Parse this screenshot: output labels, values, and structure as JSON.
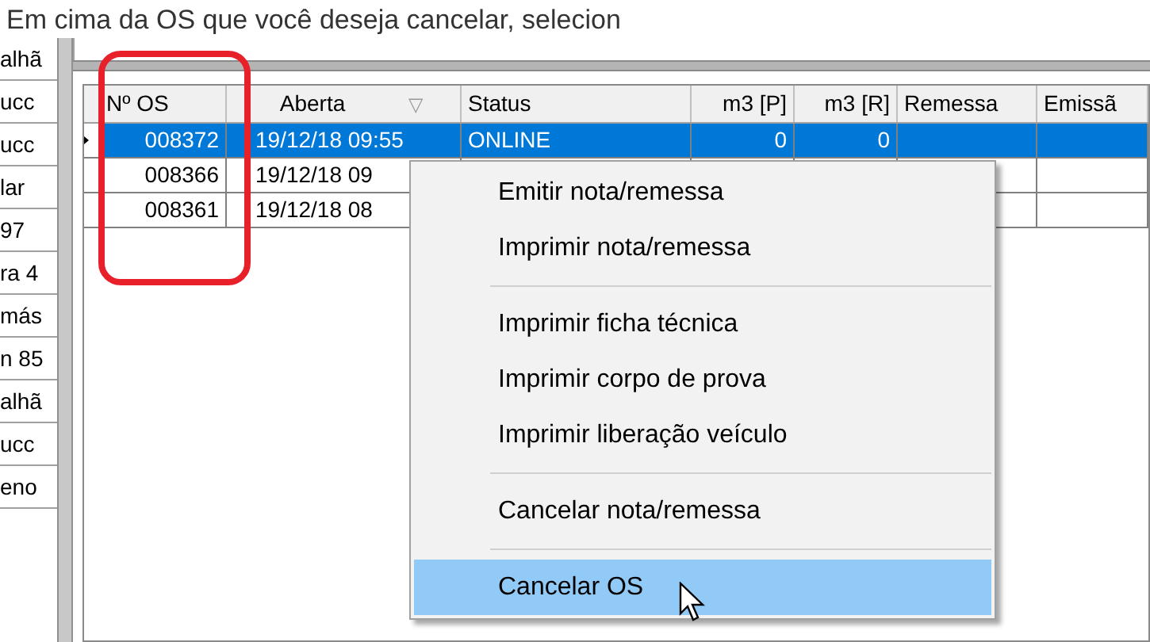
{
  "instruction": "Em cima da OS que você deseja cancelar, selecion",
  "side_list": [
    "alhã",
    "ucc",
    "ucc",
    "lar",
    "97",
    "ra 4",
    "más",
    "n 85",
    "alhã",
    "ucc",
    "eno"
  ],
  "grid": {
    "columns": [
      {
        "label": "Nº OS"
      },
      {
        "label": "Aberta",
        "sort_icon": "▽"
      },
      {
        "label": "Status"
      },
      {
        "label": "m3 [P]"
      },
      {
        "label": "m3 [R]"
      },
      {
        "label": "Remessa"
      },
      {
        "label": "Emissã"
      }
    ],
    "rows": [
      {
        "selected": true,
        "cells": [
          "008372",
          "19/12/18 09:55",
          "ONLINE",
          "0",
          "0",
          "",
          ""
        ]
      },
      {
        "selected": false,
        "cells": [
          "008366",
          "19/12/18 09",
          "",
          "",
          "",
          "",
          ""
        ]
      },
      {
        "selected": false,
        "cells": [
          "008361",
          "19/12/18 08",
          "",
          "",
          "",
          "",
          ""
        ]
      }
    ]
  },
  "context_menu": {
    "items": [
      {
        "kind": "item",
        "label": "Emitir nota/remessa",
        "selected": false
      },
      {
        "kind": "item",
        "label": "Imprimir nota/remessa",
        "selected": false
      },
      {
        "kind": "separator"
      },
      {
        "kind": "item",
        "label": "Imprimir ficha técnica",
        "selected": false
      },
      {
        "kind": "item",
        "label": "Imprimir corpo de prova",
        "selected": false
      },
      {
        "kind": "item",
        "label": "Imprimir liberação veículo",
        "selected": false
      },
      {
        "kind": "separator"
      },
      {
        "kind": "item",
        "label": "Cancelar nota/remessa",
        "selected": false
      },
      {
        "kind": "separator"
      },
      {
        "kind": "item",
        "label": "Cancelar OS",
        "selected": true
      }
    ]
  }
}
